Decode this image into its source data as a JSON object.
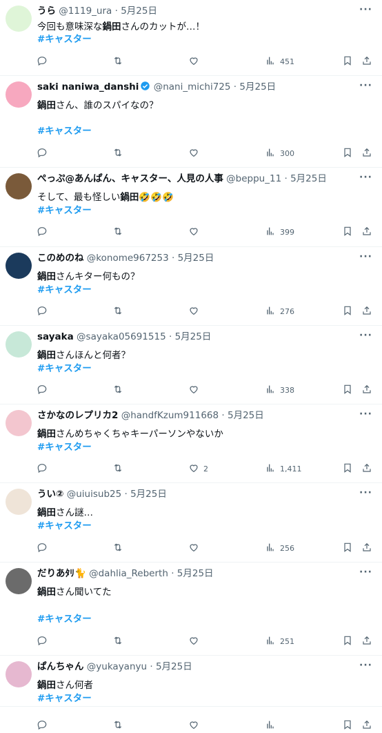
{
  "tweets": [
    {
      "name": "うら",
      "handle": "@1119_ura",
      "date": "5月25日",
      "text_pre": "今回も意味深な",
      "bold": "鍋田",
      "text_post": "さんのカットが…！",
      "hashtag": "#キャスター",
      "replies": "",
      "retweets": "",
      "likes": "",
      "views": "451",
      "avatar_color": "#dff5d8"
    },
    {
      "name": "saki naniwa_danshi",
      "handle": "@nani_michi725",
      "date": "5月25日",
      "text_pre": "",
      "bold": "鍋田",
      "text_post": "さん、誰のスパイなの？",
      "hashtag": "#キャスター",
      "replies": "",
      "retweets": "",
      "likes": "",
      "views": "300",
      "avatar_color": "#f7a8bf"
    },
    {
      "name": "ぺっぷ@あんぱん、キャスター、人見の人事",
      "handle": "@beppu_11",
      "date": "5月25日",
      "text_pre": "そして、最も怪しい",
      "bold": "鍋田",
      "text_post": "🤣🤣🤣",
      "hashtag": "#キャスター",
      "replies": "",
      "retweets": "",
      "likes": "",
      "views": "399",
      "avatar_color": "#7a5a3a"
    },
    {
      "name": "このめのね",
      "handle": "@konome967253",
      "date": "5月25日",
      "text_pre": "",
      "bold": "鍋田",
      "text_post": "さんキター何もの？",
      "hashtag": "#キャスター",
      "replies": "",
      "retweets": "",
      "likes": "",
      "views": "276",
      "avatar_color": "#1b3a5c"
    },
    {
      "name": "sayaka",
      "handle": "@sayaka05691515",
      "date": "5月25日",
      "text_pre": "",
      "bold": "鍋田",
      "text_post": "さんほんと何者？",
      "hashtag": "#キャスター",
      "replies": "",
      "retweets": "",
      "likes": "",
      "views": "338",
      "avatar_color": "#c7e8d8"
    },
    {
      "name": "さかなのレプリカ2",
      "handle": "@handfKzum911668",
      "date": "5月25日",
      "text_pre": "",
      "bold": "鍋田",
      "text_post": "さんめちゃくちゃキーパーソンやないか",
      "hashtag": "#キャスター",
      "replies": "",
      "retweets": "",
      "likes": "2",
      "views": "1,411",
      "avatar_color": "#f3c6cf"
    },
    {
      "name": "うい②",
      "handle": "@uiuisub25",
      "date": "5月25日",
      "text_pre": "",
      "bold": "鍋田",
      "text_post": "さん謎…",
      "hashtag": "#キャスター",
      "replies": "",
      "retweets": "",
      "likes": "",
      "views": "256",
      "avatar_color": "#efe4d8"
    },
    {
      "name": "だりあﾀﾘ🐈",
      "handle": "@dahlia_Reberth",
      "date": "5月25日",
      "text_pre": "",
      "bold": "鍋田",
      "text_post": "さん聞いてた",
      "hashtag": "#キャスター",
      "replies": "",
      "retweets": "",
      "likes": "",
      "views": "251",
      "avatar_color": "#6b6b6b"
    },
    {
      "name": "ぱんちゃん",
      "handle": "@yukayanyu",
      "date": "5月25日",
      "text_pre": "",
      "bold": "鍋田",
      "text_post": "さん何者",
      "hashtag": "#キャスター",
      "replies": "",
      "retweets": "",
      "likes": "",
      "views": "",
      "avatar_color": "#e6b8d0"
    }
  ],
  "separator": "·",
  "more_label": "···"
}
